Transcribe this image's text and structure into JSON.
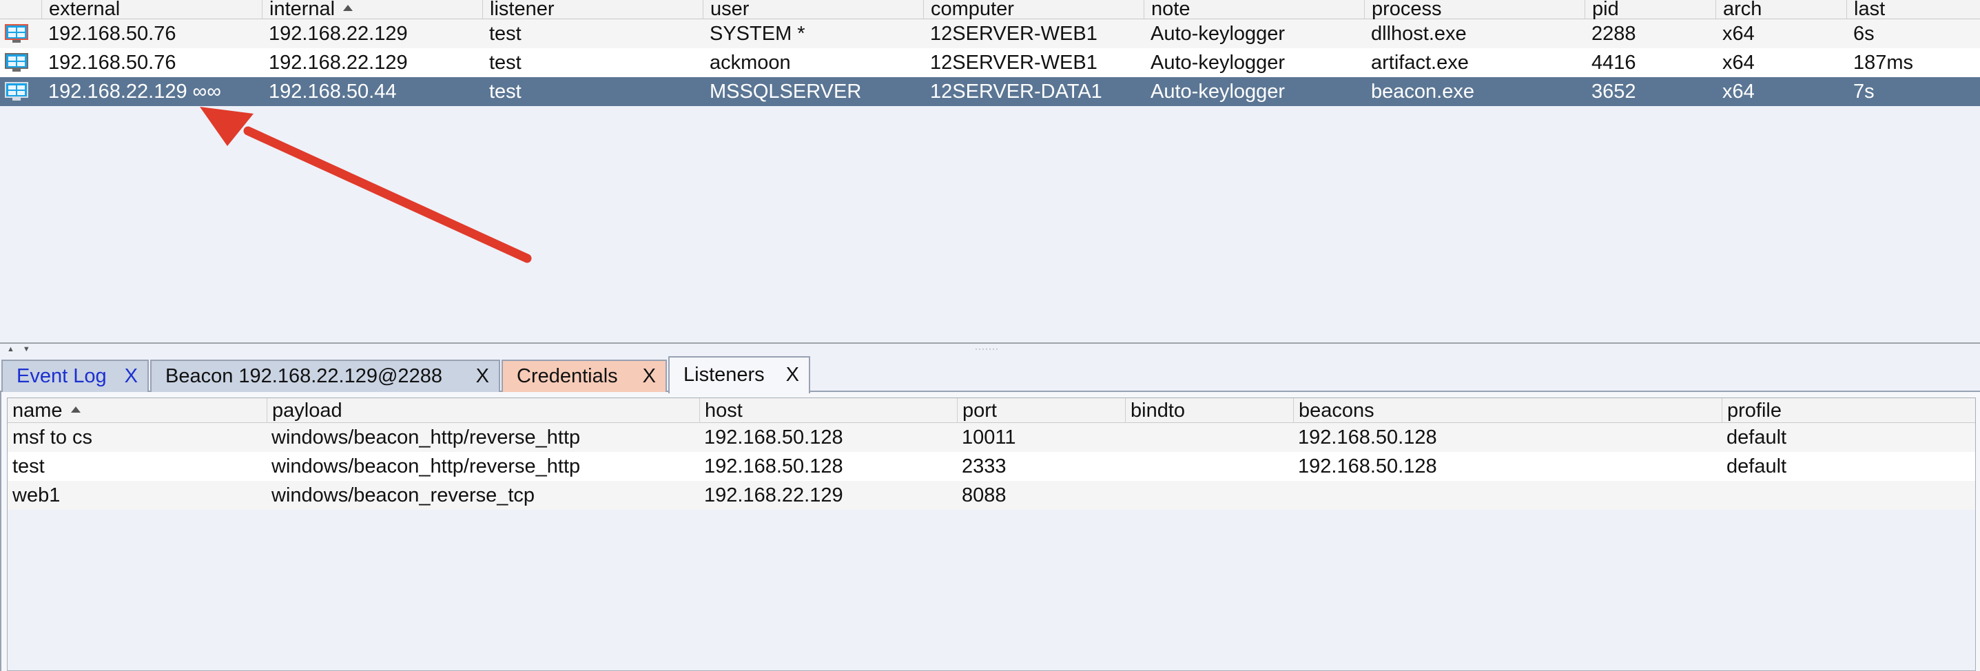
{
  "sessions": {
    "columns": [
      "",
      "external",
      "internal",
      "listener",
      "user",
      "computer",
      "note",
      "process",
      "pid",
      "arch",
      "last"
    ],
    "rows": [
      {
        "icon": "windows-desktop-icon",
        "external": "192.168.50.76",
        "internal": "192.168.22.129",
        "listener": "test",
        "user": "SYSTEM *",
        "computer": "12SERVER-WEB1",
        "note": "Auto-keylogger",
        "process": "dllhost.exe",
        "pid": "2288",
        "arch": "x64",
        "last": "6s"
      },
      {
        "icon": "windows-desktop-icon",
        "external": "192.168.50.76",
        "internal": "192.168.22.129",
        "listener": "test",
        "user": "ackmoon",
        "computer": "12SERVER-WEB1",
        "note": "Auto-keylogger",
        "process": "artifact.exe",
        "pid": "4416",
        "arch": "x64",
        "last": "187ms"
      },
      {
        "icon": "windows-desktop-icon",
        "external": "192.168.22.129 ∞∞",
        "internal": "192.168.50.44",
        "listener": "test",
        "user": "MSSQLSERVER",
        "computer": "12SERVER-DATA1",
        "note": "Auto-keylogger",
        "process": "beacon.exe",
        "pid": "3652",
        "arch": "x64",
        "last": "7s"
      }
    ]
  },
  "tabs": [
    {
      "label": "Event Log",
      "close": "X"
    },
    {
      "label": "Beacon 192.168.22.129@2288",
      "close": "X"
    },
    {
      "label": "Credentials",
      "close": "X"
    },
    {
      "label": "Listeners",
      "close": "X"
    }
  ],
  "listeners": {
    "columns": [
      "name",
      "payload",
      "host",
      "port",
      "bindto",
      "beacons",
      "profile"
    ],
    "rows": [
      {
        "name": "msf to cs",
        "payload": "windows/beacon_http/reverse_http",
        "host": "192.168.50.128",
        "port": "10011",
        "bindto": "",
        "beacons": "192.168.50.128",
        "profile": "default"
      },
      {
        "name": "test",
        "payload": "windows/beacon_http/reverse_http",
        "host": "192.168.50.128",
        "port": "2333",
        "bindto": "",
        "beacons": "192.168.50.128",
        "profile": "default"
      },
      {
        "name": "web1",
        "payload": "windows/beacon_reverse_tcp",
        "host": "192.168.22.129",
        "port": "8088",
        "bindto": "",
        "beacons": "",
        "profile": ""
      }
    ]
  },
  "colors": {
    "selected_row": "#5b7694",
    "annotation_arrow": "#e03a2b",
    "event_log_tab_text": "#1c2fd0",
    "credentials_tab": "#f6cbb8"
  }
}
